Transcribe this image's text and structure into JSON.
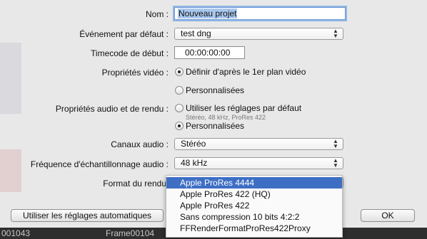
{
  "form": {
    "name_label": "Nom :",
    "name_value": "Nouveau projet",
    "event_label": "Événement par défaut :",
    "event_value": "test dng",
    "timecode_label": "Timecode de début :",
    "timecode_value": "00:00:00:00",
    "video_props_label": "Propriétés vidéo :",
    "video_option_auto": "Définir d'après le 1er plan vidéo",
    "video_option_custom": "Personnalisées",
    "audio_props_label": "Propriétés audio et de rendu :",
    "audio_option_default": "Utiliser les réglages par défaut",
    "audio_option_default_sub": "Stéréo, 48 kHz, ProRes 422",
    "audio_option_custom": "Personnalisées",
    "channels_label": "Canaux audio :",
    "channels_value": "Stéréo",
    "samplerate_label": "Fréquence d'échantillonnage audio :",
    "samplerate_value": "48 kHz",
    "render_format_label": "Format du rendu"
  },
  "render_menu": {
    "items": [
      "Apple ProRes 4444",
      "Apple ProRes 422 (HQ)",
      "Apple ProRes 422",
      "Sans compression 10 bits 4:2:2",
      "FFRenderFormatProRes422Proxy"
    ],
    "selected_index": 0
  },
  "buttons": {
    "auto_settings": "Utiliser les réglages automatiques",
    "ok": "OK"
  },
  "background": {
    "clip_left": "001043",
    "clip_frame": "Frame00104"
  },
  "colors": {
    "highlight": "#3d6ec4",
    "focus_ring": "#8fb6e6",
    "sheet": "#e8e8e8"
  }
}
